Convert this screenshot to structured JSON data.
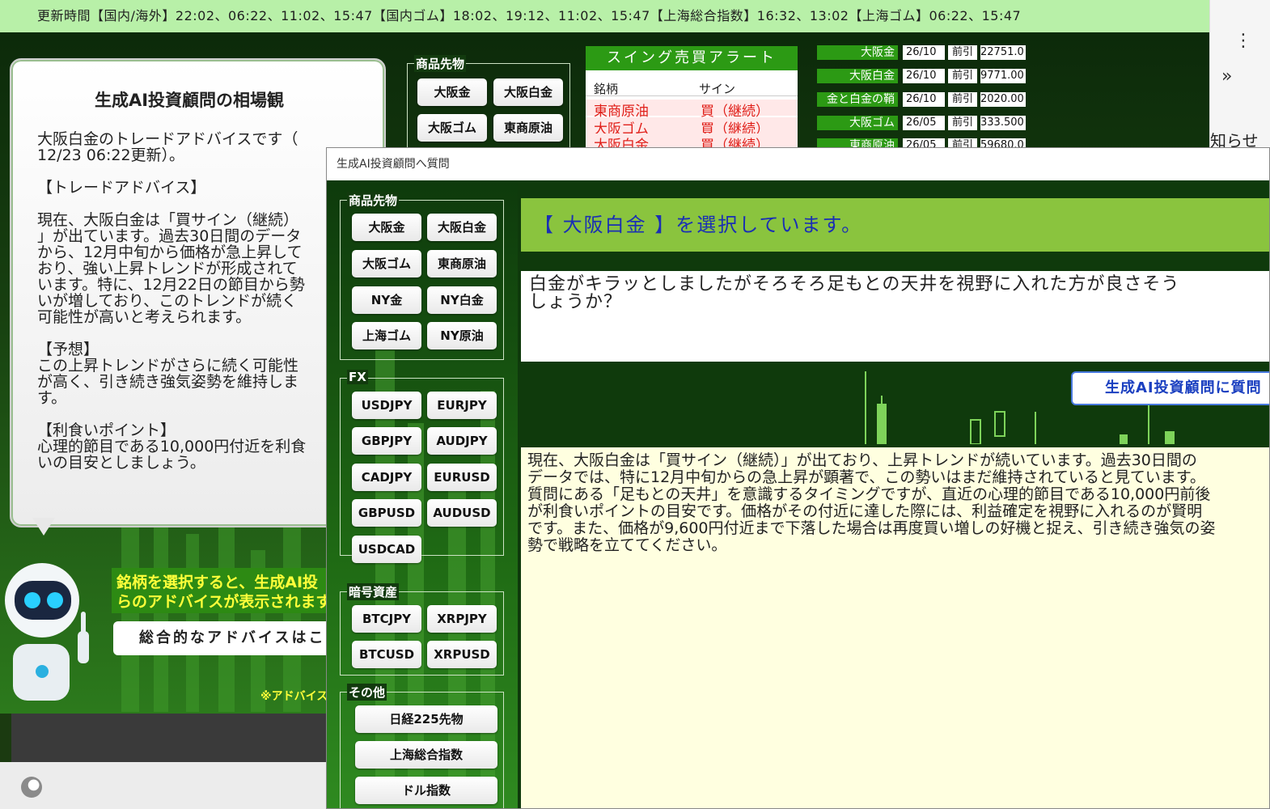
{
  "ticker": "更新時間【国内/海外】22:02、06:22、11:02、15:47【国内ゴム】18:02、19:12、11:02、15:47【上海総合指数】16:32、13:02【上海ゴム】06:22、15:47",
  "chrome": {
    "menu_icon": "⋮",
    "chevron_icon": "»",
    "notice_text": "知らせ"
  },
  "advisor": {
    "title": "生成AI投資顧問の相場観",
    "body": "大阪白金のトレードアドバイスです（\n12/23 06:22更新）。\n\n【トレードアドバイス】\n\n現在、大阪白金は「買サイン（継続）\n」が出ています。過去30日間のデータ\nから、12月中旬から価格が急上昇して\nおり、強い上昇トレンドが形成されて\nいます。特に、12月22日の節目から勢\nいが増しており、このトレンドが続く\n可能性が高いと考えられます。\n\n【予想】\nこの上昇トレンドがさらに続く可能性\nが高く、引き続き強気姿勢を維持しま\nす。\n\n【利食いポイント】\n心理的節目である10,000円付近を利食\nいの目安としましょう。",
    "robot_note": "銘柄を選択すると、生成AI投\nらのアドバイスが表示されます。",
    "overall_button": "総合的なアドバイスはこ",
    "disclaimer": "※アドバイス"
  },
  "top_commodities": {
    "legend": "商品先物",
    "buttons": [
      "大阪金",
      "大阪白金",
      "大阪ゴム",
      "東商原油"
    ]
  },
  "swing_alert": {
    "title": "スイング売買アラート",
    "col_name": "銘柄",
    "col_sign": "サイン",
    "rows": [
      {
        "name": "東商原油",
        "sign": "買（継続）"
      },
      {
        "name": "大阪ゴム",
        "sign": "買（継続）"
      },
      {
        "name": "大阪白金",
        "sign": "買（継続）"
      }
    ]
  },
  "prices": [
    {
      "name": "大阪金",
      "date": "26/10",
      "label": "前引",
      "price": "22751.0"
    },
    {
      "name": "大阪白金",
      "date": "26/10",
      "label": "前引",
      "price": "9771.00"
    },
    {
      "name": "金と白金の鞘",
      "date": "26/10",
      "label": "前引",
      "price": "2020.00"
    },
    {
      "name": "大阪ゴム",
      "date": "26/05",
      "label": "前引",
      "price": "333.500"
    },
    {
      "name": "東商原油",
      "date": "26/05",
      "label": "前引",
      "price": "59680.0"
    }
  ],
  "dialog": {
    "title": "生成AI投資顧問へ質問",
    "commodities": {
      "legend": "商品先物",
      "buttons": [
        "大阪金",
        "大阪白金",
        "大阪ゴム",
        "東商原油",
        "NY金",
        "NY白金",
        "上海ゴム",
        "NY原油"
      ]
    },
    "fx": {
      "legend": "FX",
      "buttons": [
        "USDJPY",
        "EURJPY",
        "GBPJPY",
        "AUDJPY",
        "CADJPY",
        "EURUSD",
        "GBPUSD",
        "AUDUSD",
        "USDCAD"
      ]
    },
    "crypto": {
      "legend": "暗号資産",
      "buttons": [
        "BTCJPY",
        "XRPJPY",
        "BTCUSD",
        "XRPUSD"
      ]
    },
    "other": {
      "legend": "その他",
      "buttons": [
        "日経225先物",
        "上海総合指数",
        "ドル指数"
      ]
    },
    "selected_banner": "【 大阪白金 】を選択しています。",
    "question": "白金がキラッとしましたがそろそろ足もとの天井を視野に入れた方が良さそう\nしょうか？",
    "ask_button": "生成AI投資顧問に質問",
    "answer": "現在、大阪白金は「買サイン（継続）」が出ており、上昇トレンドが続いています。過去30日間の\nデータでは、特に12月中旬からの急上昇が顕著で、この勢いはまだ維持されていると見ています。\n質問にある「足もとの天井」を意識するタイミングですが、直近の心理的節目である10,000円前後\nが利食いポイントの目安です。価格がその付近に達した際には、利益確定を視野に入れるのが賢明\nです。また、価格が9,600円付近まで下落した場合は再度買い増しの好機と捉え、引き続き強気の姿\n勢で戦略を立ててください。"
  }
}
